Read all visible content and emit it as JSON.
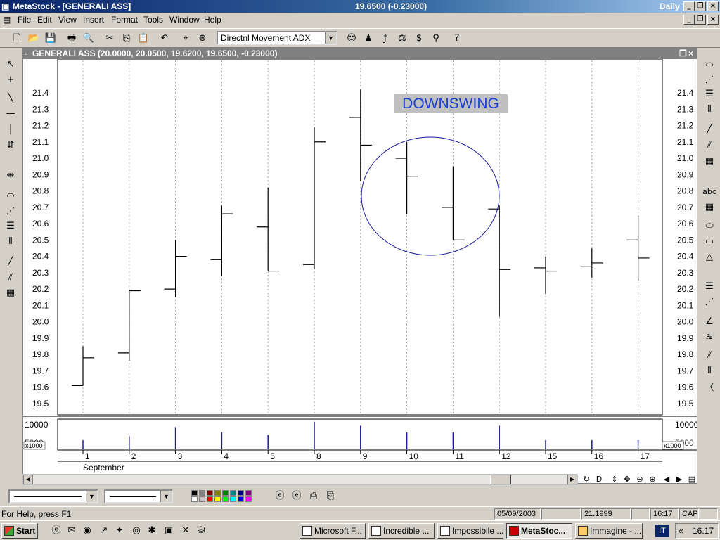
{
  "window": {
    "title": "MetaStock - [GENERALI ASS]",
    "price_readout": "19.6500 (-0.23000)",
    "period": "Daily"
  },
  "menu": [
    "File",
    "Edit",
    "View",
    "Insert",
    "Format",
    "Tools",
    "Window",
    "Help"
  ],
  "toolbar": {
    "indicator_select": "Directnl Movement ADX"
  },
  "chart_window": {
    "caption": "GENERALI ASS (20.0000, 20.0500, 19.6200, 19.6500, -0.23000)",
    "annotation": "DOWNSWING",
    "volume_scale_label": "x1000",
    "volume_tick": "10000",
    "volume_tick2": "5000",
    "month_label": "September"
  },
  "chart_data": {
    "type": "ohlc",
    "title": "GENERALI ASS",
    "x": [
      "1",
      "2",
      "3",
      "4",
      "5",
      "8",
      "9",
      "10",
      "11",
      "12",
      "15",
      "16",
      "17"
    ],
    "series": [
      {
        "open": 19.61,
        "high": 19.85,
        "low": 19.61,
        "close": 19.78
      },
      {
        "open": 19.81,
        "high": 20.19,
        "low": 19.76,
        "close": 20.19
      },
      {
        "open": 20.2,
        "high": 20.5,
        "low": 20.15,
        "close": 20.4
      },
      {
        "open": 20.38,
        "high": 20.71,
        "low": 20.28,
        "close": 20.66
      },
      {
        "open": 20.58,
        "high": 20.82,
        "low": 20.31,
        "close": 20.31
      },
      {
        "open": 20.35,
        "high": 21.19,
        "low": 20.32,
        "close": 21.1
      },
      {
        "open": 21.25,
        "high": 21.42,
        "low": 20.86,
        "close": 21.08
      },
      {
        "open": 21.0,
        "high": 21.1,
        "low": 20.66,
        "close": 20.89
      },
      {
        "open": 20.7,
        "high": 20.95,
        "low": 20.5,
        "close": 20.5
      },
      {
        "open": 20.69,
        "high": 20.71,
        "low": 20.03,
        "close": 20.32
      },
      {
        "open": 20.33,
        "high": 20.4,
        "low": 20.17,
        "close": 20.31
      },
      {
        "open": 20.34,
        "high": 20.45,
        "low": 20.27,
        "close": 20.36
      },
      {
        "open": 20.5,
        "high": 20.65,
        "low": 20.25,
        "close": 20.39
      }
    ],
    "ylim": [
      19.45,
      21.5
    ],
    "y_ticks": [
      "19.5",
      "19.6",
      "19.7",
      "19.8",
      "19.9",
      "20.0",
      "20.1",
      "20.2",
      "20.3",
      "20.4",
      "20.5",
      "20.6",
      "20.7",
      "20.8",
      "20.9",
      "21.0",
      "21.1",
      "21.2",
      "21.3",
      "21.4"
    ],
    "volume": [
      3500,
      5000,
      8500,
      6500,
      5500,
      10500,
      9000,
      6500,
      6500,
      9000,
      3500,
      3500,
      3500
    ],
    "volume_ylim": [
      0,
      11000
    ],
    "xlabel": "September"
  },
  "statusbar": {
    "help": "For Help, press F1",
    "date": "05/09/2003",
    "value": "21.1999",
    "time": "16:17",
    "caps": "CAP"
  },
  "taskbar": {
    "start": "Start",
    "buttons": [
      "Microsoft F...",
      "Incredible ...",
      "Impossibile ...",
      "MetaStoc...",
      "Immagine - ..."
    ],
    "active_index": 3,
    "lang": "IT",
    "clock": "16.17"
  },
  "colors": {
    "title_bg": "#0a246a",
    "chart_bg": "#ffffff",
    "annotation_bg": "#c0c0c0",
    "annotation_text": "#1a3fd0",
    "ellipse": "#1a1a9a",
    "volume_bar": "#1a1a9a"
  }
}
